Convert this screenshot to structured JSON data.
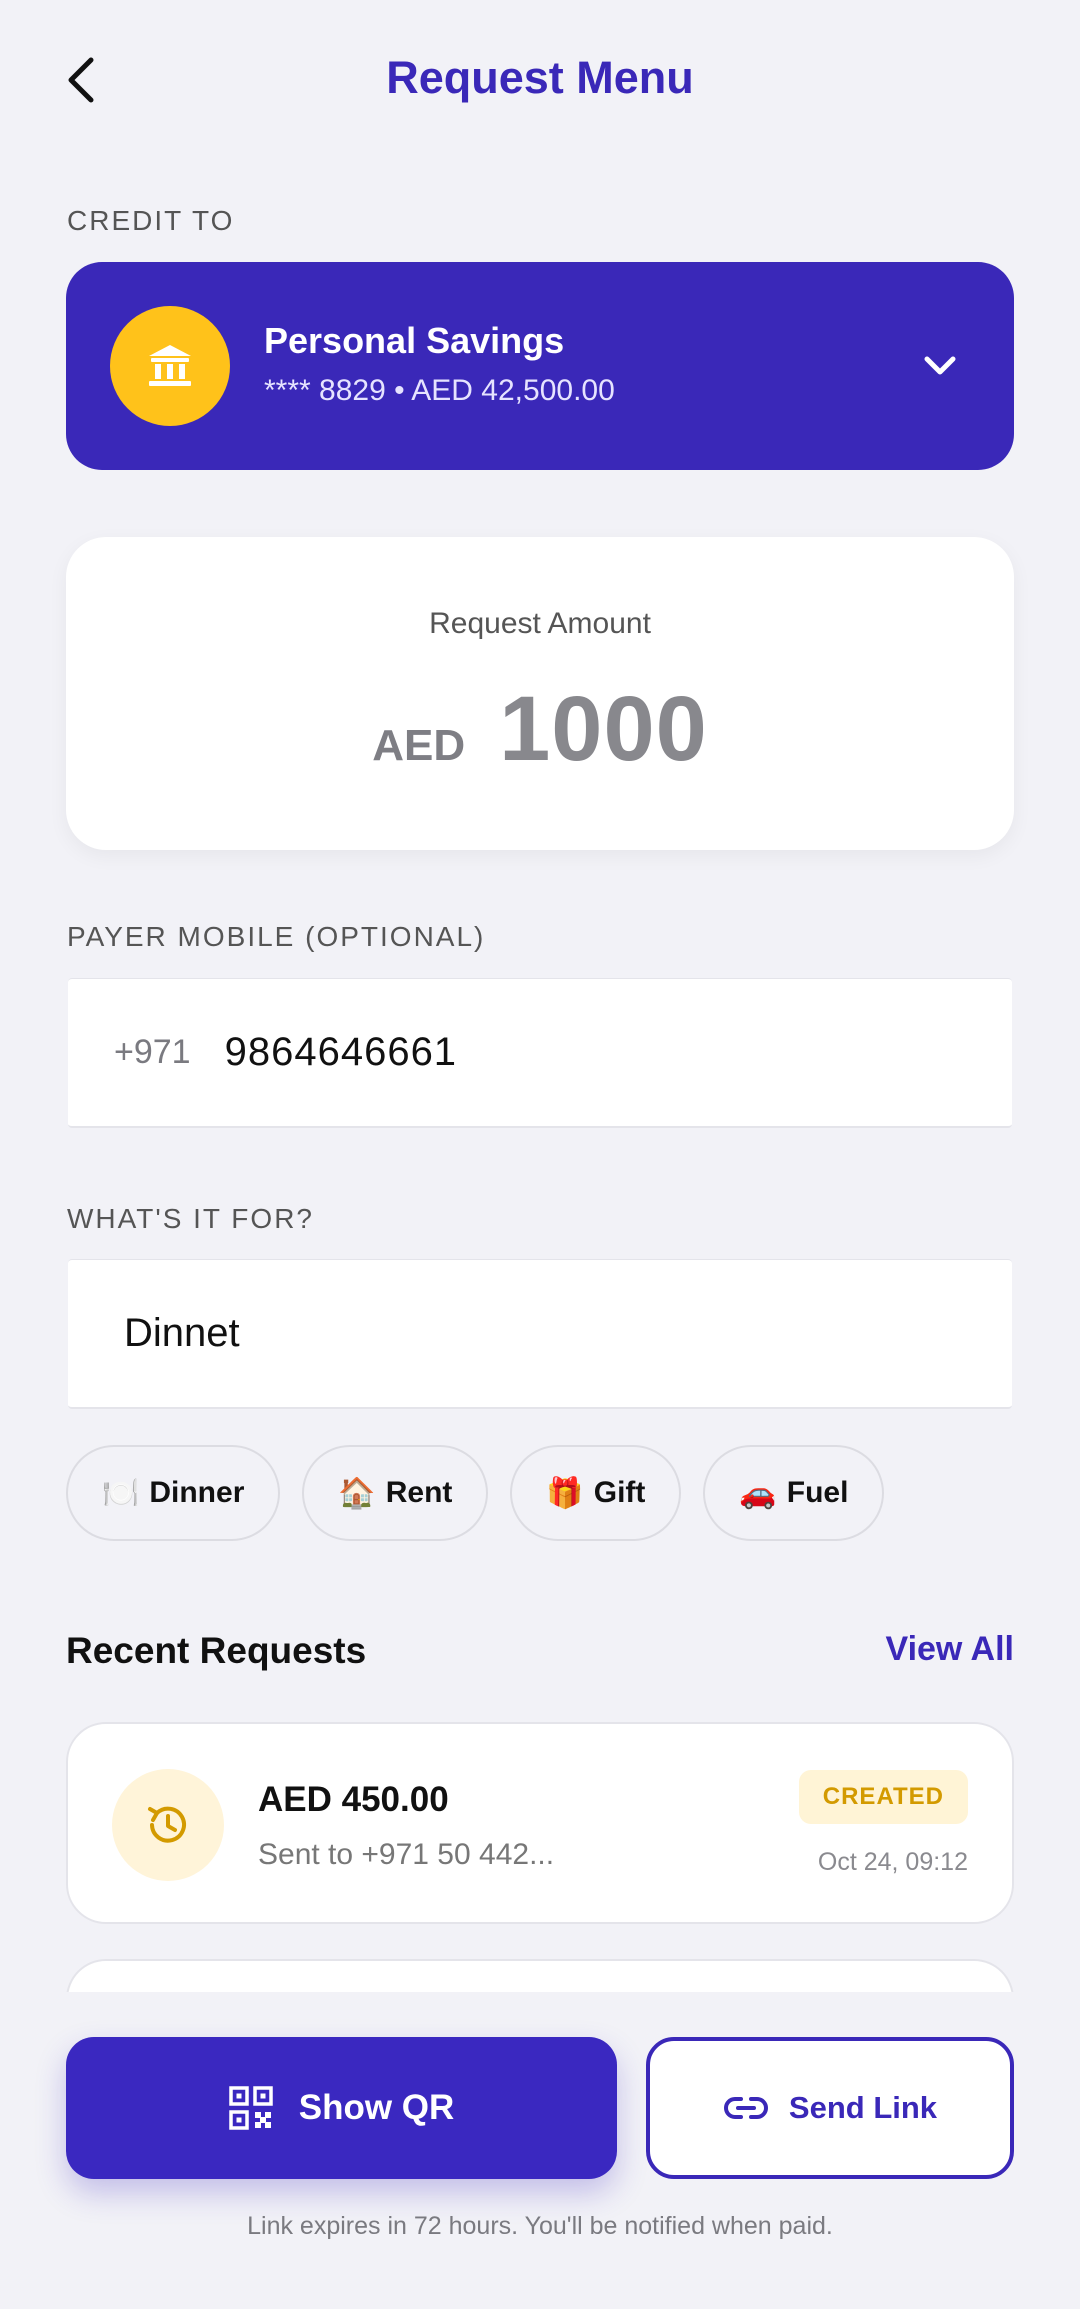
{
  "header": {
    "title": "Request Menu"
  },
  "credit_to": {
    "label": "CREDIT TO",
    "account_name": "Personal Savings",
    "account_detail": "**** 8829 • AED 42,500.00"
  },
  "amount": {
    "label": "Request Amount",
    "currency": "AED",
    "value": "1000"
  },
  "payer": {
    "label": "PAYER MOBILE (OPTIONAL)",
    "prefix": "+971",
    "value": "9864646661"
  },
  "purpose": {
    "label": "WHAT'S IT FOR?",
    "value": "Dinnet",
    "chips": [
      {
        "emoji": "🍽️",
        "label": "Dinner"
      },
      {
        "emoji": "🏠",
        "label": "Rent"
      },
      {
        "emoji": "🎁",
        "label": "Gift"
      },
      {
        "emoji": "🚗",
        "label": "Fuel"
      }
    ]
  },
  "recent": {
    "title": "Recent Requests",
    "view_all": "View All",
    "items": [
      {
        "amount": "AED 450.00",
        "subtitle": "Sent to +971 50 442...",
        "status": "CREATED",
        "time": "Oct 24, 09:12"
      }
    ]
  },
  "actions": {
    "show_qr": "Show QR",
    "send_link": "Send Link",
    "footnote": "Link expires in 72 hours. You'll be notified when paid."
  },
  "colors": {
    "brand": "#3a28b8",
    "accent_yellow": "#ffc21a",
    "status_created": "#d39a00",
    "background": "#f2f2f7"
  },
  "icons": {
    "back": "chevron-left-icon",
    "bank": "bank-icon",
    "dropdown": "chevron-down-icon",
    "history": "history-clock-icon",
    "qr": "qr-code-icon",
    "link": "link-icon"
  }
}
